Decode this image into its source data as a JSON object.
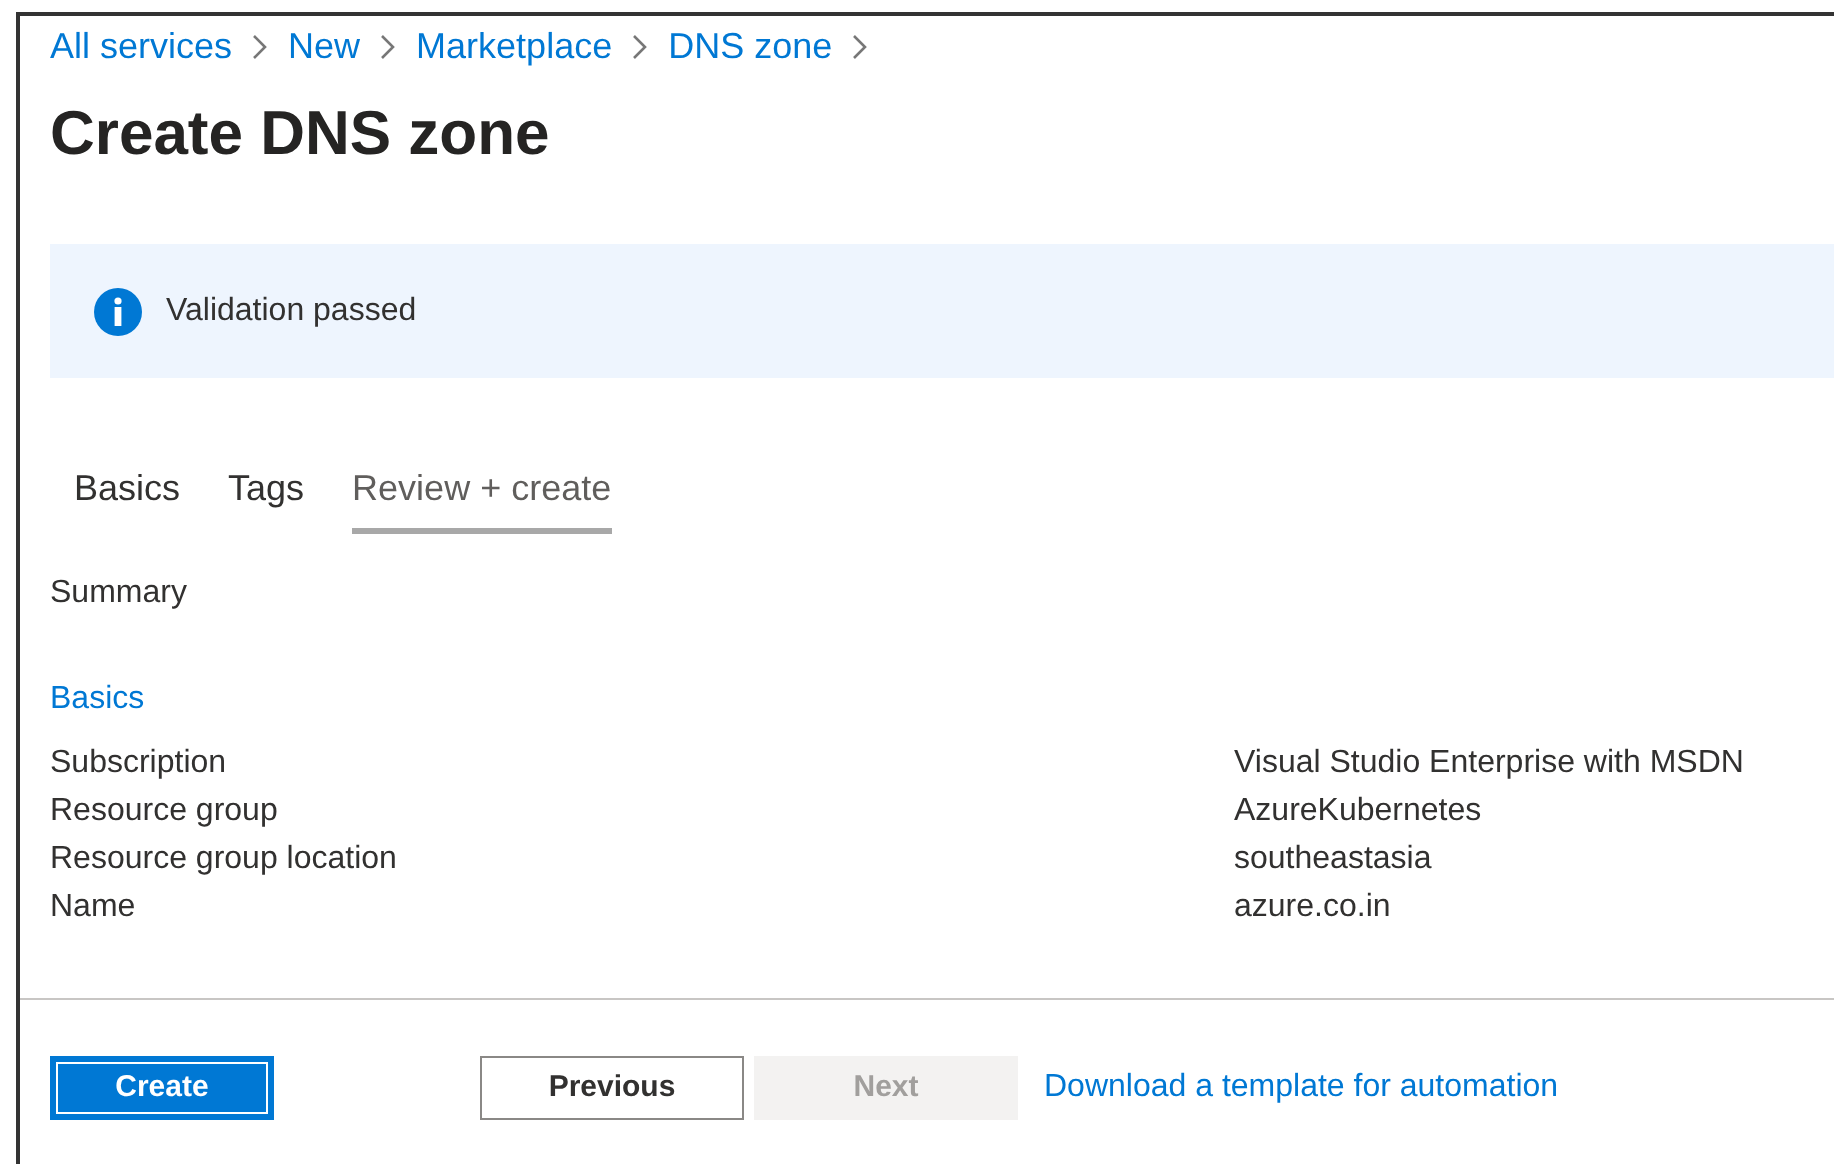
{
  "breadcrumb": [
    "All services",
    "New",
    "Marketplace",
    "DNS zone"
  ],
  "title": "Create DNS zone",
  "banner": {
    "text": "Validation passed"
  },
  "tabs": [
    {
      "label": "Basics",
      "selected": false
    },
    {
      "label": "Tags",
      "selected": false
    },
    {
      "label": "Review + create",
      "selected": true
    }
  ],
  "summary_heading": "Summary",
  "section": {
    "title": "Basics",
    "rows": [
      {
        "label": "Subscription",
        "value": "Visual Studio Enterprise with MSDN"
      },
      {
        "label": "Resource group",
        "value": "AzureKubernetes"
      },
      {
        "label": "Resource group location",
        "value": "southeastasia"
      },
      {
        "label": "Name",
        "value": "azure.co.in"
      }
    ]
  },
  "actions": [
    {
      "kind": "primary",
      "label": "Create",
      "disabled": false
    },
    {
      "kind": "secondary",
      "label": "Previous",
      "disabled": false
    },
    {
      "kind": "secondary",
      "label": "Next",
      "disabled": true
    },
    {
      "kind": "link",
      "label": "Download a template for automation",
      "disabled": false
    }
  ]
}
